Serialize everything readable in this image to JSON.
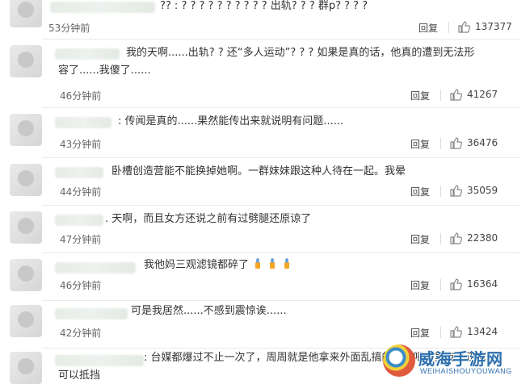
{
  "reply_label": "回复",
  "comments": [
    {
      "prefix": "",
      "text": "?? : ? ? ? ? ? ? ? ? ? ? 出轨? ? ? 群p? ? ? ?",
      "time": "53分钟前",
      "likes": "137377"
    },
    {
      "prefix": "",
      "text": "我的天啊......出轨? ? 还“多人运动”? ? ? 如果是真的话，他真的遭到无法形",
      "text2": "容了......我傻了......",
      "time": "46分钟前",
      "likes": "41267"
    },
    {
      "prefix": "",
      "text": ": 传闻是真的......果然能传出来就说明有问题......",
      "time": "43分钟前",
      "likes": "36476"
    },
    {
      "prefix": "",
      "text": "卧槽创造营能不能换掉她啊。一群妹妹跟这种人待在一起。我晕",
      "time": "44分钟前",
      "likes": "35059"
    },
    {
      "prefix": "",
      "text": ". 天啊，而且女方还说之前有过劈腿还原谅了",
      "time": "47分钟前",
      "likes": "22380"
    },
    {
      "prefix": "",
      "text": "我他妈三观滤镜都碎了",
      "time": "46分钟前",
      "likes": "16364"
    },
    {
      "prefix": "",
      "text": "可是我居然......不感到震惊诶......",
      "time": "42分钟前",
      "likes": "13424"
    },
    {
      "prefix": "",
      "text": ": 台媒都爆过不止一次了，周周就是他拿来外面乱搞的幌子吧真里有个正宫",
      "text2": "可以抵挡",
      "time": "",
      "likes": ""
    }
  ],
  "watermark": {
    "title": "威海手游网",
    "subtitle": "WEIHAISHOUYOUWANG"
  },
  "colors": {
    "thumb": "#888888",
    "accent": "#f5a623"
  }
}
